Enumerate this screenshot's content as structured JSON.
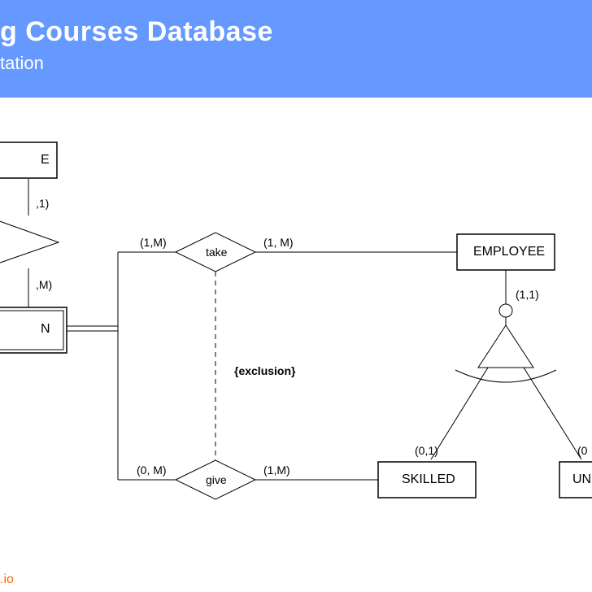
{
  "header": {
    "title_fragment": "g Courses Database",
    "subtitle_fragment": "tation"
  },
  "entities": {
    "box_top_left": "E",
    "box_mid_left": "N",
    "employee": "EMPLOYEE",
    "skilled": "SKILLED",
    "unskilled_fragment": "UN"
  },
  "relations": {
    "take": "take",
    "give": "give",
    "exclusion": "{exclusion}"
  },
  "cardinalities": {
    "c_top_left_1": ",1)",
    "c_top_left_2": ",M)",
    "take_left": "(1,M)",
    "take_right": "(1, M)",
    "emp_gen": "(1,1)",
    "give_left": "(0, M)",
    "give_right": "(1,M)",
    "skilled_top": "(0,1)",
    "unskilled_top": "(0"
  },
  "footer": {
    "text": ".io"
  }
}
